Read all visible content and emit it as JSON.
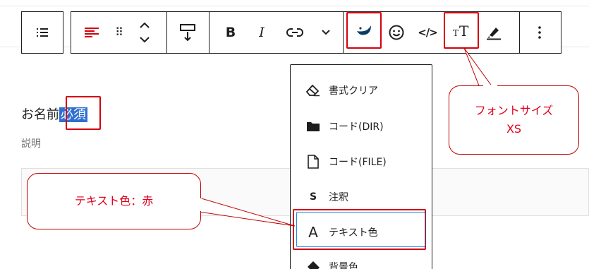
{
  "toolbar": {
    "items": [
      {
        "name": "list-view-icon",
        "glyph": "☰"
      },
      {
        "name": "align-icon"
      },
      {
        "name": "drag-handle-icon",
        "glyph": "⠿"
      },
      {
        "name": "move-up-down-icon"
      },
      {
        "name": "line-height-icon"
      },
      {
        "name": "bold-icon",
        "glyph": "B"
      },
      {
        "name": "italic-icon",
        "glyph": "I"
      },
      {
        "name": "link-icon",
        "glyph": "⊂⊃"
      },
      {
        "name": "more-chevron-icon",
        "glyph": "⌄"
      },
      {
        "name": "brand-plugin-icon"
      },
      {
        "name": "emoji-icon",
        "glyph": "☺"
      },
      {
        "name": "code-icon",
        "glyph": "</>"
      },
      {
        "name": "font-size-icon",
        "glyph": "TT"
      },
      {
        "name": "highlighter-icon"
      },
      {
        "name": "options-kebab-icon",
        "glyph": "⋮"
      }
    ]
  },
  "content": {
    "field_label": "お名前",
    "required_badge": "必須",
    "description": "説明"
  },
  "dropdown": {
    "items": [
      {
        "label": "書式クリア",
        "icon": "eraser-icon"
      },
      {
        "label": "コード(DIR)",
        "icon": "folder-icon"
      },
      {
        "label": "コード(FILE)",
        "icon": "file-icon"
      },
      {
        "label": "注釈",
        "icon": "annotation-s-icon",
        "glyph": "S"
      },
      {
        "label": "テキスト色",
        "icon": "text-color-a-icon",
        "glyph": "A"
      },
      {
        "label": "背景色",
        "icon": "background-color-icon"
      }
    ]
  },
  "callouts": {
    "font_size_line1": "フォントサイズ",
    "font_size_line2": "XS",
    "text_color": "テキスト色：赤"
  },
  "colors": {
    "annotation_red": "#d4000f",
    "selection_blue": "#2f6fd1",
    "toolbar_border": "#1e1e1e",
    "brand_icon": "#0b3d63"
  }
}
